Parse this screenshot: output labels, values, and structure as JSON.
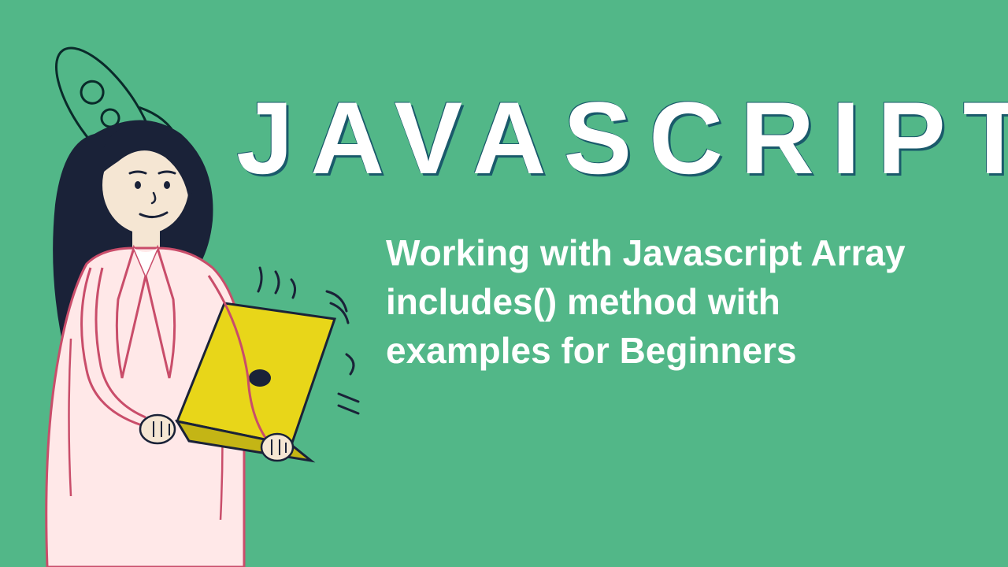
{
  "title": "JAVASCRIPT",
  "subtitle": "Working with Javascript Array includes() method with examples for Beginners"
}
